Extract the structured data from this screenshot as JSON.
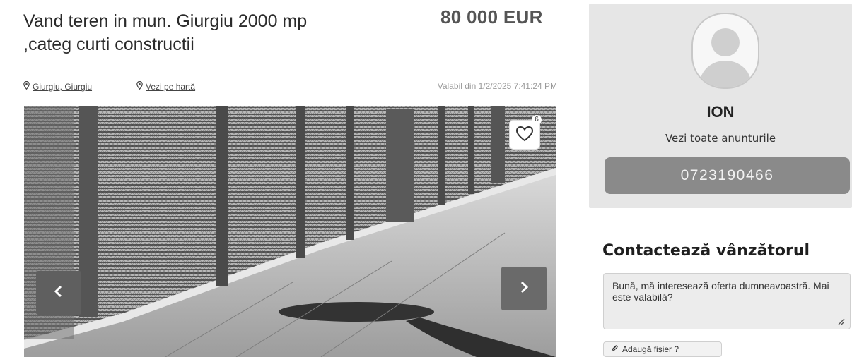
{
  "listing": {
    "title_line1": "Vand teren in mun. Giurgiu 2000 mp",
    "title_line2": ",categ curti constructii",
    "price": "80 000 EUR",
    "location_link": "Giurgiu, Giurgiu",
    "map_link": "Vezi pe hartă",
    "posted": "Valabil din 1/2/2025 7:41:24 PM",
    "favorite_count": "6"
  },
  "icons": {
    "location": "map-pin-icon",
    "favorite": "heart-icon",
    "prev": "chevron-left-icon",
    "next": "chevron-right-icon",
    "attach": "paperclip-icon",
    "resize": "resize-grip-icon"
  },
  "seller": {
    "name": "ION",
    "see_all_label": "Vezi toate anunturile",
    "phone": "0723190466"
  },
  "contact": {
    "title": "Contactează vânzătorul",
    "message": "Bună, mă interesează oferta dumneavoastră. Mai este valabilă?",
    "attach_label": "Adaugă fișier ?"
  },
  "colors": {
    "card_bg": "#e6e6e6",
    "phone_bg": "#8a8a8a",
    "nav_btn": "#6a6a6a"
  }
}
